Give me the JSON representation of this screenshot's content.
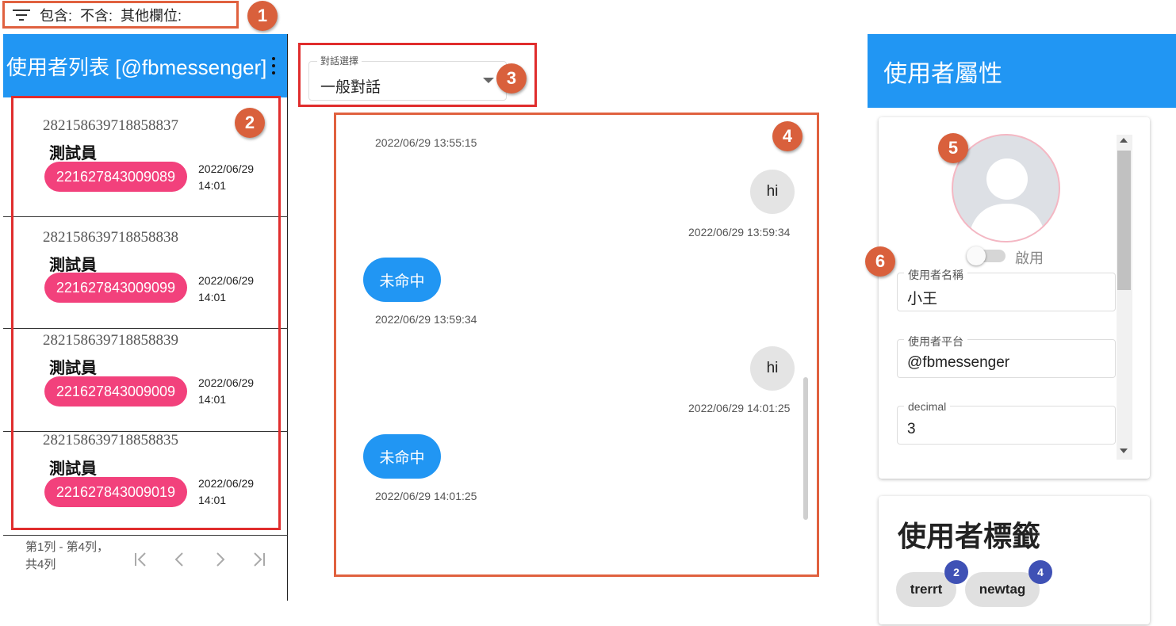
{
  "filter_bar": {
    "icon": "filter-icon",
    "text": "包含:  不含:  其他欄位:"
  },
  "user_list": {
    "title": "使用者列表 [@fbmessenger]",
    "menu_icon": "more-vert-icon",
    "items": [
      {
        "id": "282158639718858837",
        "name": "測試員",
        "tag": "221627843009089",
        "date": "2022/06/29",
        "time": "14:01"
      },
      {
        "id": "282158639718858838",
        "name": "測試員",
        "tag": "221627843009099",
        "date": "2022/06/29",
        "time": "14:01"
      },
      {
        "id": "282158639718858839",
        "name": "測試員",
        "tag": "221627843009009",
        "date": "2022/06/29",
        "time": "14:01"
      },
      {
        "id": "282158639718858835",
        "name": "測試員",
        "tag": "221627843009019",
        "date": "2022/06/29",
        "time": "14:01"
      }
    ],
    "pager": {
      "text": "第1列 - 第4列，共4列",
      "first": "|<",
      "prev": "<",
      "next": ">",
      "last": ">|"
    }
  },
  "conversation": {
    "select_label": "對話選擇",
    "select_value": "一般對話",
    "messages": [
      {
        "side": "top",
        "text": "",
        "time": "2022/06/29 13:55:15"
      },
      {
        "side": "in",
        "text": "hi",
        "time": "2022/06/29 13:59:34"
      },
      {
        "side": "out",
        "text": "未命中",
        "time": "2022/06/29 13:59:34"
      },
      {
        "side": "in",
        "text": "hi",
        "time": "2022/06/29 14:01:25"
      },
      {
        "side": "out",
        "text": "未命中",
        "time": "2022/06/29 14:01:25"
      }
    ]
  },
  "user_attributes": {
    "title": "使用者屬性",
    "avatar_icon": "person-icon",
    "toggle_label": "啟用",
    "toggle_on": false,
    "fields": [
      {
        "label": "使用者名稱",
        "value": "小王"
      },
      {
        "label": "使用者平台",
        "value": "@fbmessenger"
      },
      {
        "label": "decimal",
        "value": "3"
      }
    ]
  },
  "user_tags": {
    "title": "使用者標籤",
    "tags": [
      {
        "label": "trerrt",
        "count": "2"
      },
      {
        "label": "newtag",
        "count": "4"
      }
    ]
  },
  "callouts": [
    "1",
    "2",
    "3",
    "4",
    "5",
    "6"
  ],
  "colors": {
    "header_blue": "#2196f3",
    "pill_pink": "#f2417c",
    "badge_indigo": "#3f51b5",
    "callout_orange": "#d9603c",
    "highlight_red": "#e02d2d"
  }
}
